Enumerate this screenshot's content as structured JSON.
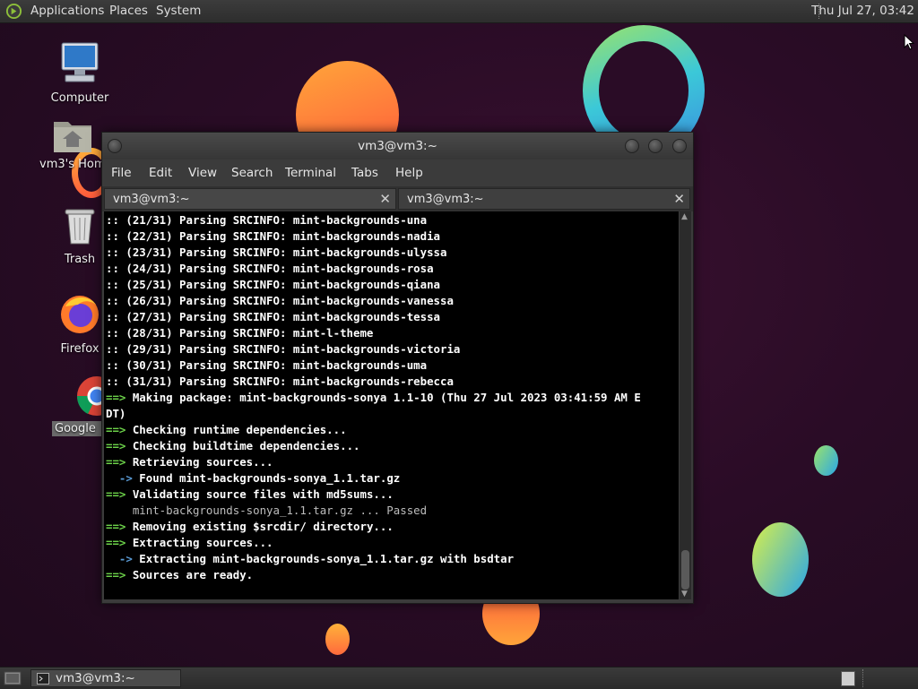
{
  "top_panel": {
    "menus": [
      "Applications",
      "Places",
      "System"
    ],
    "clock": "Thu Jul 27, 03:42"
  },
  "desktop_icons": [
    {
      "label": "Computer",
      "icon": "computer-icon"
    },
    {
      "label": "vm3's Home",
      "icon": "home-folder-icon"
    },
    {
      "label": "Trash",
      "icon": "trash-icon"
    },
    {
      "label": "Firefox",
      "icon": "firefox-icon"
    },
    {
      "label": "Google",
      "icon": "chrome-icon"
    }
  ],
  "terminal": {
    "title": "vm3@vm3:~",
    "menu": [
      "File",
      "Edit",
      "View",
      "Search",
      "Terminal",
      "Tabs",
      "Help"
    ],
    "tabs": [
      {
        "label": "vm3@vm3:~",
        "close": "✕"
      },
      {
        "label": "vm3@vm3:~",
        "close": "✕"
      }
    ],
    "lines": [
      {
        "prefix": "::",
        "text": " (21/31) Parsing SRCINFO: mint-backgrounds-una"
      },
      {
        "prefix": "::",
        "text": " (22/31) Parsing SRCINFO: mint-backgrounds-nadia"
      },
      {
        "prefix": "::",
        "text": " (23/31) Parsing SRCINFO: mint-backgrounds-ulyssa"
      },
      {
        "prefix": "::",
        "text": " (24/31) Parsing SRCINFO: mint-backgrounds-rosa"
      },
      {
        "prefix": "::",
        "text": " (25/31) Parsing SRCINFO: mint-backgrounds-qiana"
      },
      {
        "prefix": "::",
        "text": " (26/31) Parsing SRCINFO: mint-backgrounds-vanessa"
      },
      {
        "prefix": "::",
        "text": " (27/31) Parsing SRCINFO: mint-backgrounds-tessa"
      },
      {
        "prefix": "::",
        "text": " (28/31) Parsing SRCINFO: mint-l-theme"
      },
      {
        "prefix": "::",
        "text": " (29/31) Parsing SRCINFO: mint-backgrounds-victoria"
      },
      {
        "prefix": "::",
        "text": " (30/31) Parsing SRCINFO: mint-backgrounds-uma"
      },
      {
        "prefix": "::",
        "text": " (31/31) Parsing SRCINFO: mint-backgrounds-rebecca"
      },
      {
        "prefix": "==>",
        "text": " Making package: mint-backgrounds-sonya 1.1-10 (Thu 27 Jul 2023 03:41:59 AM E"
      },
      {
        "prefix": "",
        "text": "DT)"
      },
      {
        "prefix": "==>",
        "text": " Checking runtime dependencies..."
      },
      {
        "prefix": "==>",
        "text": " Checking buildtime dependencies..."
      },
      {
        "prefix": "==>",
        "text": " Retrieving sources..."
      },
      {
        "prefix": "  ->",
        "text": " Found mint-backgrounds-sonya_1.1.tar.gz"
      },
      {
        "prefix": "==>",
        "text": " Validating source files with md5sums..."
      },
      {
        "prefix": "",
        "text": "    mint-backgrounds-sonya_1.1.tar.gz ... Passed",
        "muted": true
      },
      {
        "prefix": "==>",
        "text": " Removing existing $srcdir/ directory..."
      },
      {
        "prefix": "==>",
        "text": " Extracting sources..."
      },
      {
        "prefix": "  ->",
        "text": " Extracting mint-backgrounds-sonya_1.1.tar.gz with bsdtar"
      },
      {
        "prefix": "==>",
        "text": " Sources are ready."
      }
    ]
  },
  "taskbar": {
    "window_button": "vm3@vm3:~"
  },
  "colors": {
    "prompt_arrow": "#6dd34a",
    "sub_arrow": "#5a9bd5",
    "terminal_bg": "#000000"
  }
}
